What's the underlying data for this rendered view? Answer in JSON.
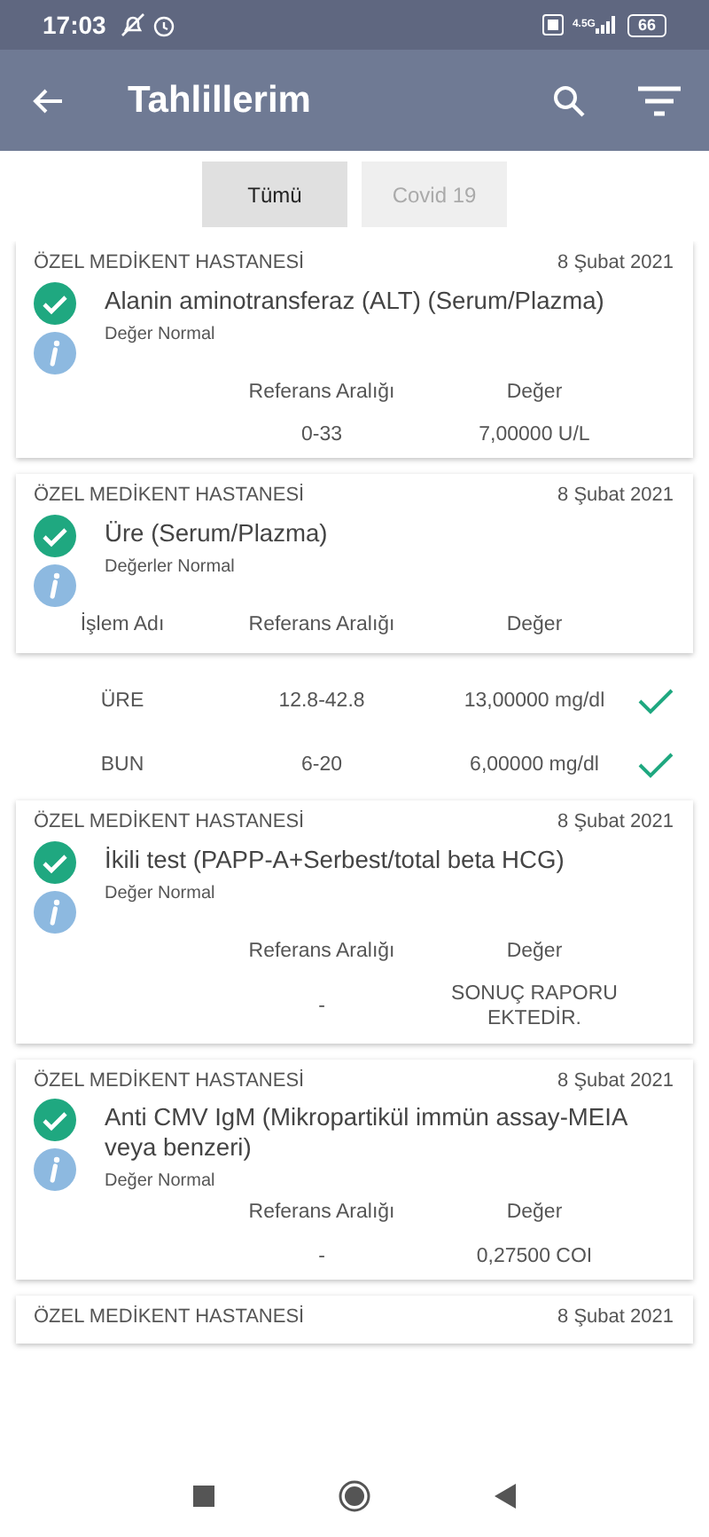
{
  "status_bar": {
    "time": "17:03",
    "network": "4.5G",
    "battery": "66"
  },
  "app_bar": {
    "title": "Tahlillerim"
  },
  "filters": [
    {
      "label": "Tümü",
      "selected": true
    },
    {
      "label": "Covid 19",
      "selected": false
    }
  ],
  "results": [
    {
      "hospital": "ÖZEL MEDİKENT HASTANESİ",
      "date": "8 Şubat 2021",
      "title": "Alanin aminotransferaz (ALT) (Serum/Plazma)",
      "status": "Değer Normal",
      "normal": true,
      "columns": [
        "Referans Aralığı",
        "Değer"
      ],
      "rows": [
        [
          "0-33",
          "7,00000 U/L"
        ]
      ]
    },
    {
      "hospital": "ÖZEL MEDİKENT HASTANESİ",
      "date": "8 Şubat 2021",
      "title": "Üre (Serum/Plazma)",
      "status": "Değerler Normal",
      "normal": true,
      "columns": [
        "İşlem Adı",
        "Referans Aralığı",
        "Değer"
      ],
      "sub_rows": [
        {
          "cells": [
            "ÜRE",
            "12.8-42.8",
            "13,00000 mg/dl"
          ],
          "normal": true
        },
        {
          "cells": [
            "BUN",
            "6-20",
            "6,00000 mg/dl"
          ],
          "normal": true
        }
      ]
    },
    {
      "hospital": "ÖZEL MEDİKENT HASTANESİ",
      "date": "8 Şubat 2021",
      "title": "İkili test (PAPP-A+Serbest/total beta HCG)",
      "status": "Değer Normal",
      "normal": true,
      "columns": [
        "Referans Aralığı",
        "Değer"
      ],
      "rows": [
        [
          "-",
          "SONUÇ RAPORU EKTEDİR."
        ]
      ]
    },
    {
      "hospital": "ÖZEL MEDİKENT HASTANESİ",
      "date": "8 Şubat 2021",
      "title": "Anti CMV IgM (Mikropartikül immün assay-MEIA veya benzeri)",
      "status": "Değer Normal",
      "normal": true,
      "columns": [
        "Referans Aralığı",
        "Değer"
      ],
      "rows": [
        [
          "-",
          "0,27500 COI"
        ]
      ]
    },
    {
      "hospital": "ÖZEL MEDİKENT HASTANESİ",
      "date": "8 Şubat 2021"
    }
  ]
}
